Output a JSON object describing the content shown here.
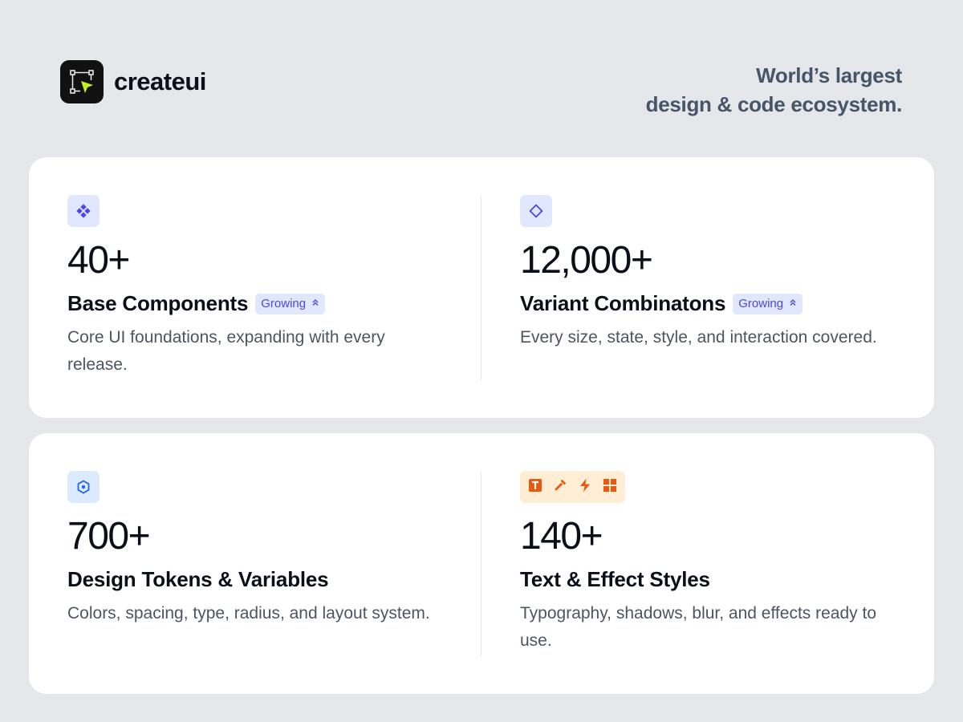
{
  "brand": {
    "name": "createui",
    "logo_icon": "cursor-selection-icon"
  },
  "tagline": {
    "line1": "World’s largest",
    "line2": "design & code ecosystem."
  },
  "stats": [
    {
      "icon": "components-icon",
      "value": "40+",
      "title": "Base Components",
      "badge": "Growing",
      "description": "Core UI foundations, expanding with every release."
    },
    {
      "icon": "variant-diamond-icon",
      "value": "12,000+",
      "title": "Variant Combinatons",
      "badge": "Growing",
      "description": "Every size, state, style, and interaction covered."
    },
    {
      "icon": "token-hexagon-icon",
      "value": "700+",
      "title": "Design Tokens & Variables",
      "description": "Colors, spacing, type, radius, and layout system."
    },
    {
      "icons": [
        "text-style-icon",
        "color-picker-icon",
        "effect-bolt-icon",
        "grid-layout-icon"
      ],
      "value": "140+",
      "title": "Text & Effect Styles",
      "description": "Typography, shadows, blur, and effects ready to use."
    }
  ],
  "colors": {
    "page_bg": "#e5e7eb",
    "card_bg": "#ffffff",
    "accent_purple": "#4f46e5",
    "accent_blue": "#2563eb",
    "accent_orange": "#ea580c",
    "logo_green": "#c6f01e"
  }
}
